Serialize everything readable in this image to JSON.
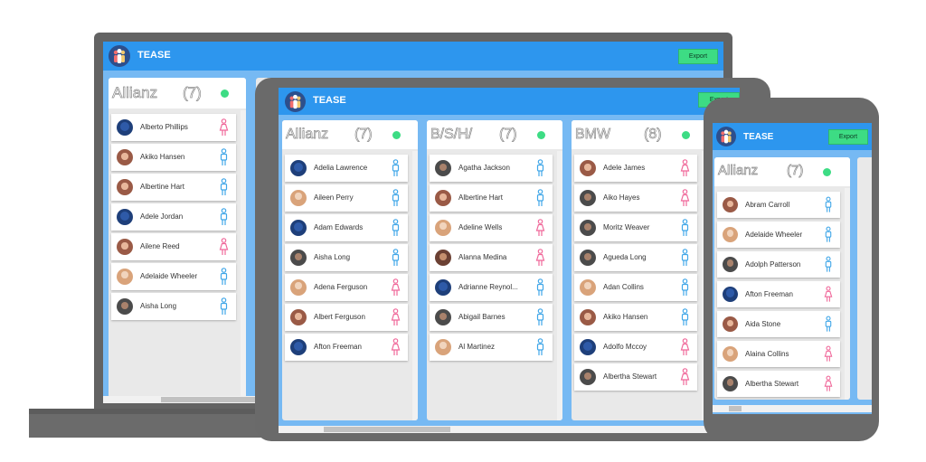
{
  "app": {
    "title": "TEASE",
    "export_label": "Export",
    "colors": {
      "topbar": "#2d96ee",
      "background": "#76b9f3",
      "export": "#3ddc84",
      "male": "#3fa6e8",
      "female": "#f0689a"
    }
  },
  "laptop": {
    "columns": [
      {
        "name": "Allianz",
        "count": "(7)",
        "people": [
          {
            "name": "Alberto Phillips",
            "gender": "female",
            "avatar": "a1"
          },
          {
            "name": "Akiko Hansen",
            "gender": "male",
            "avatar": "a2"
          },
          {
            "name": "Albertine Hart",
            "gender": "male",
            "avatar": "a2"
          },
          {
            "name": "Adele Jordan",
            "gender": "male",
            "avatar": "a1"
          },
          {
            "name": "Ailene Reed",
            "gender": "female",
            "avatar": "a2"
          },
          {
            "name": "Adelaide Wheeler",
            "gender": "male",
            "avatar": "a4"
          },
          {
            "name": "Aisha Long",
            "gender": "male",
            "avatar": "a3"
          }
        ]
      }
    ]
  },
  "tablet": {
    "columns": [
      {
        "name": "Allianz",
        "count": "(7)",
        "people": [
          {
            "name": "Adelia Lawrence",
            "gender": "male",
            "avatar": "a1"
          },
          {
            "name": "Aileen Perry",
            "gender": "male",
            "avatar": "a4"
          },
          {
            "name": "Adam Edwards",
            "gender": "male",
            "avatar": "a1"
          },
          {
            "name": "Aisha Long",
            "gender": "male",
            "avatar": "a3"
          },
          {
            "name": "Adena Ferguson",
            "gender": "female",
            "avatar": "a4"
          },
          {
            "name": "Albert Ferguson",
            "gender": "female",
            "avatar": "a2"
          },
          {
            "name": "Afton Freeman",
            "gender": "female",
            "avatar": "a1"
          }
        ]
      },
      {
        "name": "B/S/H/",
        "count": "(7)",
        "people": [
          {
            "name": "Agatha Jackson",
            "gender": "male",
            "avatar": "a3"
          },
          {
            "name": "Albertine Hart",
            "gender": "male",
            "avatar": "a2"
          },
          {
            "name": "Adeline Wells",
            "gender": "female",
            "avatar": "a4"
          },
          {
            "name": "Alanna Medina",
            "gender": "female",
            "avatar": "a5"
          },
          {
            "name": "Adrianne Reynol...",
            "gender": "male",
            "avatar": "a1"
          },
          {
            "name": "Abigail Barnes",
            "gender": "male",
            "avatar": "a3"
          },
          {
            "name": "Al Martinez",
            "gender": "male",
            "avatar": "a4"
          }
        ]
      },
      {
        "name": "BMW",
        "count": "(8)",
        "people": [
          {
            "name": "Adele James",
            "gender": "female",
            "avatar": "a2"
          },
          {
            "name": "Aiko Hayes",
            "gender": "female",
            "avatar": "a3"
          },
          {
            "name": "Moritz Weaver",
            "gender": "male",
            "avatar": "a3"
          },
          {
            "name": "Agueda Long",
            "gender": "male",
            "avatar": "a3"
          },
          {
            "name": "Adan Collins",
            "gender": "male",
            "avatar": "a4"
          },
          {
            "name": "Akiko Hansen",
            "gender": "male",
            "avatar": "a2"
          },
          {
            "name": "Adolfo Mccoy",
            "gender": "female",
            "avatar": "a1"
          },
          {
            "name": "Albertha Stewart",
            "gender": "female",
            "avatar": "a3"
          }
        ]
      }
    ]
  },
  "phone": {
    "columns": [
      {
        "name": "Allianz",
        "count": "(7)",
        "people": [
          {
            "name": "Abram Carroll",
            "gender": "male",
            "avatar": "a2"
          },
          {
            "name": "Adelaide Wheeler",
            "gender": "male",
            "avatar": "a4"
          },
          {
            "name": "Adolph Patterson",
            "gender": "male",
            "avatar": "a3"
          },
          {
            "name": "Afton Freeman",
            "gender": "female",
            "avatar": "a1"
          },
          {
            "name": "Aida Stone",
            "gender": "male",
            "avatar": "a2"
          },
          {
            "name": "Alaina Collins",
            "gender": "female",
            "avatar": "a4"
          },
          {
            "name": "Albertha Stewart",
            "gender": "female",
            "avatar": "a3"
          }
        ]
      }
    ]
  }
}
